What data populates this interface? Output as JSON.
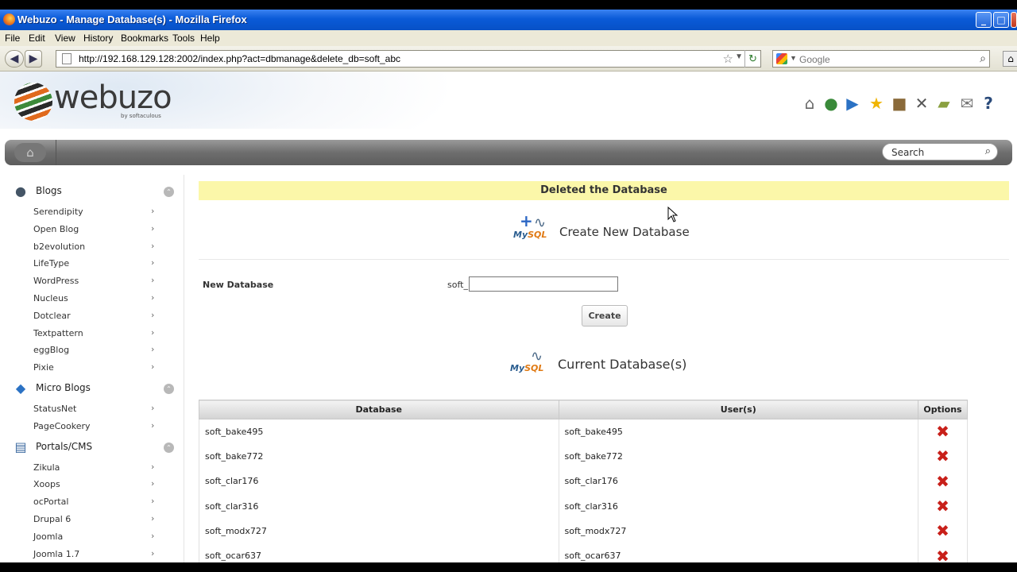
{
  "window": {
    "title": "Webuzo - Manage Database(s) - Mozilla Firefox",
    "min": "_",
    "max": "□",
    "close": "✕"
  },
  "menu": [
    "File",
    "Edit",
    "View",
    "History",
    "Bookmarks",
    "Tools",
    "Help"
  ],
  "browser": {
    "url": "http://192.168.129.128:2002/index.php?act=dbmanage&delete_db=soft_abc",
    "search_placeholder": "Google"
  },
  "header": {
    "logo": "webuzo",
    "logo_sub": "by softaculous",
    "icons": [
      "home-icon",
      "globe-icon",
      "play-icon",
      "star-icon",
      "box-icon",
      "tools-icon",
      "folder-icon",
      "mail-icon",
      "help-icon"
    ]
  },
  "topbar": {
    "search_placeholder": "Search"
  },
  "sidebar": {
    "categories": [
      {
        "label": "Blogs",
        "items": [
          "Serendipity",
          "Open Blog",
          "b2evolution",
          "LifeType",
          "WordPress",
          "Nucleus",
          "Dotclear",
          "Textpattern",
          "eggBlog",
          "Pixie"
        ]
      },
      {
        "label": "Micro Blogs",
        "items": [
          "StatusNet",
          "PageCookery"
        ]
      },
      {
        "label": "Portals/CMS",
        "items": [
          "Zikula",
          "Xoops",
          "ocPortal",
          "Drupal 6",
          "Joomla",
          "Joomla 1.7"
        ]
      }
    ]
  },
  "main": {
    "notice": "Deleted the Database",
    "create_title": "Create New Database",
    "new_db_label": "New Database",
    "prefix": "soft_",
    "new_db_value": "",
    "create_button": "Create",
    "current_title": "Current Database(s)",
    "table": {
      "headers": [
        "Database",
        "User(s)",
        "Options"
      ],
      "rows": [
        {
          "db": "soft_bake495",
          "user": "soft_bake495"
        },
        {
          "db": "soft_bake772",
          "user": "soft_bake772"
        },
        {
          "db": "soft_clar176",
          "user": "soft_clar176"
        },
        {
          "db": "soft_clar316",
          "user": "soft_clar316"
        },
        {
          "db": "soft_modx727",
          "user": "soft_modx727"
        },
        {
          "db": "soft_ocar637",
          "user": "soft_ocar637"
        }
      ]
    }
  },
  "colors": {
    "notice_bg": "#fbf7a9",
    "delete_red": "#c8201a",
    "titlebar_blue": "#0a5ad8"
  }
}
